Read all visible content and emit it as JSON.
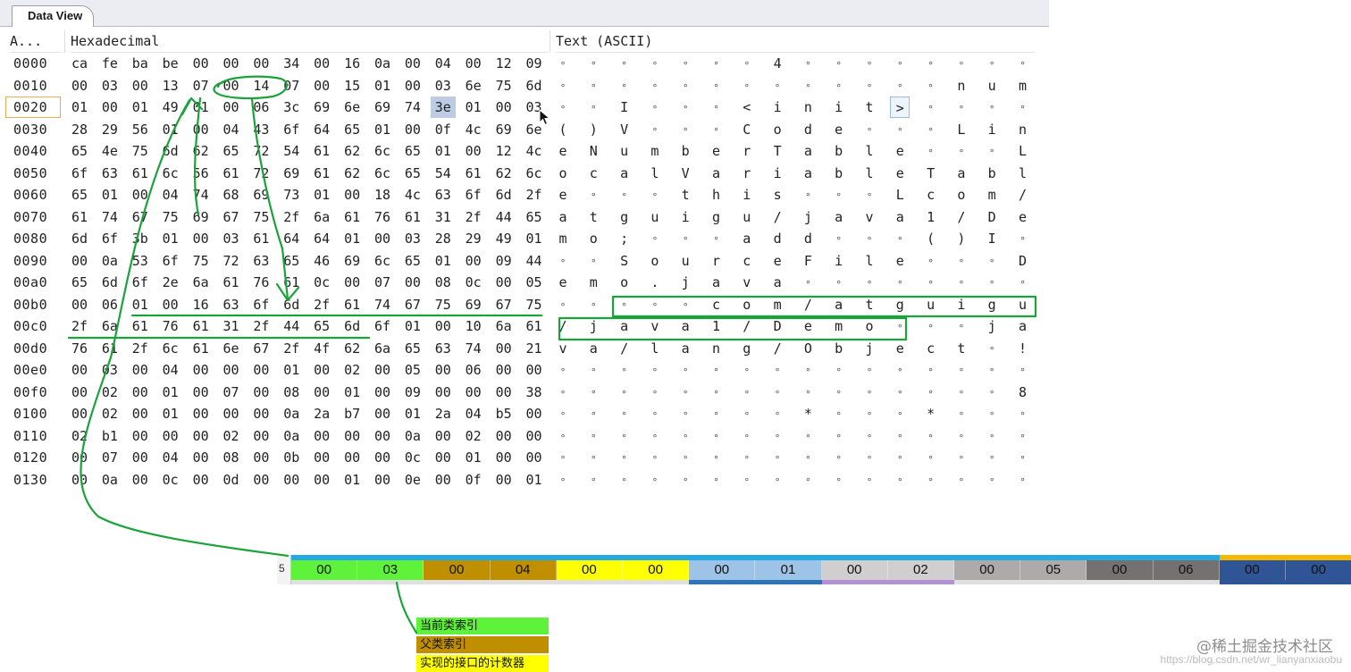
{
  "tab": {
    "label": "Data View"
  },
  "columns": {
    "address": "A...",
    "hex": "Hexadecimal",
    "text": "Text (ASCII)"
  },
  "selection": {
    "row": 2,
    "col": 12,
    "address": "0020",
    "hex": "3e",
    "text": ">"
  },
  "rows": [
    {
      "addr": "0000",
      "hex": [
        "ca",
        "fe",
        "ba",
        "be",
        "00",
        "00",
        "00",
        "34",
        "00",
        "16",
        "0a",
        "00",
        "04",
        "00",
        "12",
        "09"
      ],
      "text": [
        "",
        "",
        "",
        "",
        "",
        "",
        "",
        "4",
        "",
        "",
        "",
        "",
        "",
        "",
        "",
        ""
      ]
    },
    {
      "addr": "0010",
      "hex": [
        "00",
        "03",
        "00",
        "13",
        "07",
        "00",
        "14",
        "07",
        "00",
        "15",
        "01",
        "00",
        "03",
        "6e",
        "75",
        "6d"
      ],
      "text": [
        "",
        "",
        "",
        "",
        "",
        "",
        "",
        "",
        "",
        "",
        "",
        "",
        "",
        "n",
        "u",
        "m"
      ]
    },
    {
      "addr": "0020",
      "hex": [
        "01",
        "00",
        "01",
        "49",
        "01",
        "00",
        "06",
        "3c",
        "69",
        "6e",
        "69",
        "74",
        "3e",
        "01",
        "00",
        "03"
      ],
      "text": [
        "",
        "",
        "I",
        "",
        "",
        "",
        "<",
        "i",
        "n",
        "i",
        "t",
        ">",
        "",
        "",
        "",
        ""
      ]
    },
    {
      "addr": "0030",
      "hex": [
        "28",
        "29",
        "56",
        "01",
        "00",
        "04",
        "43",
        "6f",
        "64",
        "65",
        "01",
        "00",
        "0f",
        "4c",
        "69",
        "6e"
      ],
      "text": [
        "(",
        ")",
        "V",
        "",
        "",
        "",
        "C",
        "o",
        "d",
        "e",
        "",
        "",
        "",
        "L",
        "i",
        "n"
      ]
    },
    {
      "addr": "0040",
      "hex": [
        "65",
        "4e",
        "75",
        "6d",
        "62",
        "65",
        "72",
        "54",
        "61",
        "62",
        "6c",
        "65",
        "01",
        "00",
        "12",
        "4c"
      ],
      "text": [
        "e",
        "N",
        "u",
        "m",
        "b",
        "e",
        "r",
        "T",
        "a",
        "b",
        "l",
        "e",
        "",
        "",
        "",
        "L"
      ]
    },
    {
      "addr": "0050",
      "hex": [
        "6f",
        "63",
        "61",
        "6c",
        "56",
        "61",
        "72",
        "69",
        "61",
        "62",
        "6c",
        "65",
        "54",
        "61",
        "62",
        "6c"
      ],
      "text": [
        "o",
        "c",
        "a",
        "l",
        "V",
        "a",
        "r",
        "i",
        "a",
        "b",
        "l",
        "e",
        "T",
        "a",
        "b",
        "l"
      ]
    },
    {
      "addr": "0060",
      "hex": [
        "65",
        "01",
        "00",
        "04",
        "74",
        "68",
        "69",
        "73",
        "01",
        "00",
        "18",
        "4c",
        "63",
        "6f",
        "6d",
        "2f"
      ],
      "text": [
        "e",
        "",
        "",
        "",
        "t",
        "h",
        "i",
        "s",
        "",
        "",
        "",
        "L",
        "c",
        "o",
        "m",
        "/"
      ]
    },
    {
      "addr": "0070",
      "hex": [
        "61",
        "74",
        "67",
        "75",
        "69",
        "67",
        "75",
        "2f",
        "6a",
        "61",
        "76",
        "61",
        "31",
        "2f",
        "44",
        "65"
      ],
      "text": [
        "a",
        "t",
        "g",
        "u",
        "i",
        "g",
        "u",
        "/",
        "j",
        "a",
        "v",
        "a",
        "1",
        "/",
        "D",
        "e"
      ]
    },
    {
      "addr": "0080",
      "hex": [
        "6d",
        "6f",
        "3b",
        "01",
        "00",
        "03",
        "61",
        "64",
        "64",
        "01",
        "00",
        "03",
        "28",
        "29",
        "49",
        "01"
      ],
      "text": [
        "m",
        "o",
        ";",
        "",
        "",
        "",
        "a",
        "d",
        "d",
        "",
        "",
        "",
        "(",
        ")",
        "I",
        ""
      ]
    },
    {
      "addr": "0090",
      "hex": [
        "00",
        "0a",
        "53",
        "6f",
        "75",
        "72",
        "63",
        "65",
        "46",
        "69",
        "6c",
        "65",
        "01",
        "00",
        "09",
        "44"
      ],
      "text": [
        "",
        "",
        "S",
        "o",
        "u",
        "r",
        "c",
        "e",
        "F",
        "i",
        "l",
        "e",
        "",
        "",
        "",
        "D"
      ]
    },
    {
      "addr": "00a0",
      "hex": [
        "65",
        "6d",
        "6f",
        "2e",
        "6a",
        "61",
        "76",
        "61",
        "0c",
        "00",
        "07",
        "00",
        "08",
        "0c",
        "00",
        "05"
      ],
      "text": [
        "e",
        "m",
        "o",
        ".",
        "j",
        "a",
        "v",
        "a",
        "",
        "",
        "",
        "",
        "",
        "",
        "",
        ""
      ]
    },
    {
      "addr": "00b0",
      "hex": [
        "00",
        "06",
        "01",
        "00",
        "16",
        "63",
        "6f",
        "6d",
        "2f",
        "61",
        "74",
        "67",
        "75",
        "69",
        "67",
        "75"
      ],
      "text": [
        "",
        "",
        "",
        "",
        "",
        "c",
        "o",
        "m",
        "/",
        "a",
        "t",
        "g",
        "u",
        "i",
        "g",
        "u"
      ]
    },
    {
      "addr": "00c0",
      "hex": [
        "2f",
        "6a",
        "61",
        "76",
        "61",
        "31",
        "2f",
        "44",
        "65",
        "6d",
        "6f",
        "01",
        "00",
        "10",
        "6a",
        "61"
      ],
      "text": [
        "/",
        "j",
        "a",
        "v",
        "a",
        "1",
        "/",
        "D",
        "e",
        "m",
        "o",
        "",
        "",
        "",
        "j",
        "a"
      ]
    },
    {
      "addr": "00d0",
      "hex": [
        "76",
        "61",
        "2f",
        "6c",
        "61",
        "6e",
        "67",
        "2f",
        "4f",
        "62",
        "6a",
        "65",
        "63",
        "74",
        "00",
        "21"
      ],
      "text": [
        "v",
        "a",
        "/",
        "l",
        "a",
        "n",
        "g",
        "/",
        "O",
        "b",
        "j",
        "e",
        "c",
        "t",
        "",
        "!"
      ]
    },
    {
      "addr": "00e0",
      "hex": [
        "00",
        "03",
        "00",
        "04",
        "00",
        "00",
        "00",
        "01",
        "00",
        "02",
        "00",
        "05",
        "00",
        "06",
        "00",
        "00"
      ],
      "text": [
        "",
        "",
        "",
        "",
        "",
        "",
        "",
        "",
        "",
        "",
        "",
        "",
        "",
        "",
        "",
        ""
      ]
    },
    {
      "addr": "00f0",
      "hex": [
        "00",
        "02",
        "00",
        "01",
        "00",
        "07",
        "00",
        "08",
        "00",
        "01",
        "00",
        "09",
        "00",
        "00",
        "00",
        "38"
      ],
      "text": [
        "",
        "",
        "",
        "",
        "",
        "",
        "",
        "",
        "",
        "",
        "",
        "",
        "",
        "",
        "",
        "8"
      ]
    },
    {
      "addr": "0100",
      "hex": [
        "00",
        "02",
        "00",
        "01",
        "00",
        "00",
        "00",
        "0a",
        "2a",
        "b7",
        "00",
        "01",
        "2a",
        "04",
        "b5",
        "00"
      ],
      "text": [
        "",
        "",
        "",
        "",
        "",
        "",
        "",
        "",
        "*",
        "",
        "",
        "",
        "*",
        "",
        "",
        ""
      ]
    },
    {
      "addr": "0110",
      "hex": [
        "02",
        "b1",
        "00",
        "00",
        "00",
        "02",
        "00",
        "0a",
        "00",
        "00",
        "00",
        "0a",
        "00",
        "02",
        "00",
        "00"
      ],
      "text": [
        "",
        "",
        "",
        "",
        "",
        "",
        "",
        "",
        "",
        "",
        "",
        "",
        "",
        "",
        "",
        ""
      ]
    },
    {
      "addr": "0120",
      "hex": [
        "00",
        "07",
        "00",
        "04",
        "00",
        "08",
        "00",
        "0b",
        "00",
        "00",
        "00",
        "0c",
        "00",
        "01",
        "00",
        "00"
      ],
      "text": [
        "",
        "",
        "",
        "",
        "",
        "",
        "",
        "",
        "",
        "",
        "",
        "",
        "",
        "",
        "",
        ""
      ]
    },
    {
      "addr": "0130",
      "hex": [
        "00",
        "0a",
        "00",
        "0c",
        "00",
        "0d",
        "00",
        "00",
        "00",
        "01",
        "00",
        "0e",
        "00",
        "0f",
        "00",
        "01"
      ],
      "text": [
        "",
        "",
        "",
        "",
        "",
        "",
        "",
        "",
        "",
        "",
        "",
        "",
        "",
        "",
        "",
        ""
      ]
    }
  ],
  "compare_table": {
    "row_label": "5",
    "cells": [
      {
        "value": "00",
        "color": "#5ff23a"
      },
      {
        "value": "03",
        "color": "#5ff23a"
      },
      {
        "value": "00",
        "color": "#bf8f00"
      },
      {
        "value": "04",
        "color": "#bf8f00"
      },
      {
        "value": "00",
        "color": "#ffff00"
      },
      {
        "value": "00",
        "color": "#ffff00"
      },
      {
        "value": "00",
        "color": "#9dc3e6"
      },
      {
        "value": "01",
        "color": "#9dc3e6"
      },
      {
        "value": "00",
        "color": "#d0cece"
      },
      {
        "value": "02",
        "color": "#d0cece"
      },
      {
        "value": "00",
        "color": "#aeaaaa"
      },
      {
        "value": "05",
        "color": "#aeaaaa"
      },
      {
        "value": "00",
        "color": "#767171"
      },
      {
        "value": "06",
        "color": "#767171"
      },
      {
        "value": "00",
        "color": "#2f5597"
      },
      {
        "value": "00",
        "color": "#2f5597"
      }
    ]
  },
  "legend": [
    {
      "label": "当前类索引",
      "color": "#5ff23a"
    },
    {
      "label": "父类索引",
      "color": "#bf8f00"
    },
    {
      "label": "实现的接口的计数器",
      "color": "#ffff00"
    }
  ],
  "watermark": {
    "text": "@稀土掘金技术社区",
    "url": "https://blog.csdn.net/wr_lianyanxiaobu"
  },
  "colors": {
    "annotation": "#1aa33a",
    "selection": "#bccde3",
    "address_selection": "#e6a957"
  }
}
